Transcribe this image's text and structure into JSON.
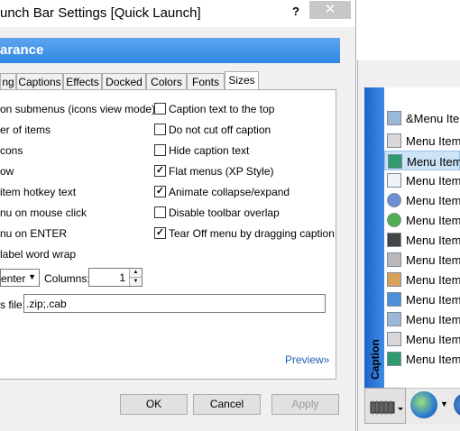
{
  "window": {
    "title": "unch Bar Settings [Quick Launch]",
    "help_label": "?",
    "close_label": "✕"
  },
  "header": {
    "title": "arance"
  },
  "tabs": [
    {
      "label": "ng"
    },
    {
      "label": "Captions"
    },
    {
      "label": "Effects"
    },
    {
      "label": "Docked"
    },
    {
      "label": "Colors"
    },
    {
      "label": "Fonts"
    },
    {
      "label": "Sizes"
    }
  ],
  "left_options": [
    "on submenus (icons view mode)",
    "er of items",
    "cons",
    "ow",
    "item hotkey text",
    "nu on mouse click",
    "nu on ENTER",
    "label word wrap"
  ],
  "right_options": [
    {
      "label": "Caption text to the top",
      "checked": false
    },
    {
      "label": "Do not cut off caption",
      "checked": false
    },
    {
      "label": "Hide caption text",
      "checked": false
    },
    {
      "label": "Flat menus (XP Style)",
      "checked": true
    },
    {
      "label": "Animate collapse/expand",
      "checked": true
    },
    {
      "label": "Disable toolbar overlap",
      "checked": false
    },
    {
      "label": "Tear Off menu by dragging caption",
      "checked": true
    }
  ],
  "alignment": {
    "value": "enter"
  },
  "columns": {
    "label": "Columns:",
    "value": "1"
  },
  "extensions": {
    "label": "s file:",
    "value": ".zip;.cab"
  },
  "preview_label": "Preview»",
  "buttons": {
    "ok": "OK",
    "cancel": "Cancel",
    "apply": "Apply"
  },
  "menu": {
    "caption": "Caption",
    "items": [
      {
        "label": "&Menu Iter",
        "icon": "app-icon"
      },
      {
        "label": "Menu Item",
        "icon": "printer-icon"
      },
      {
        "label": "Menu Item",
        "icon": "monitor-icon",
        "selected": true
      },
      {
        "label": "Menu Item",
        "icon": "checklist-icon"
      },
      {
        "label": "Menu Item",
        "icon": "gauge-icon"
      },
      {
        "label": "Menu Item",
        "icon": "network-globe-icon"
      },
      {
        "label": "Menu Item",
        "icon": "speaker-icon"
      },
      {
        "label": "Menu Item",
        "icon": "camera-icon"
      },
      {
        "label": "Menu Item",
        "icon": "users-icon"
      },
      {
        "label": "Menu Item",
        "icon": "window-icon"
      },
      {
        "label": "Menu Item",
        "icon": "app-icon"
      },
      {
        "label": "Menu Item",
        "icon": "printer-icon"
      },
      {
        "label": "Menu Item",
        "icon": "monitor-icon"
      }
    ]
  }
}
